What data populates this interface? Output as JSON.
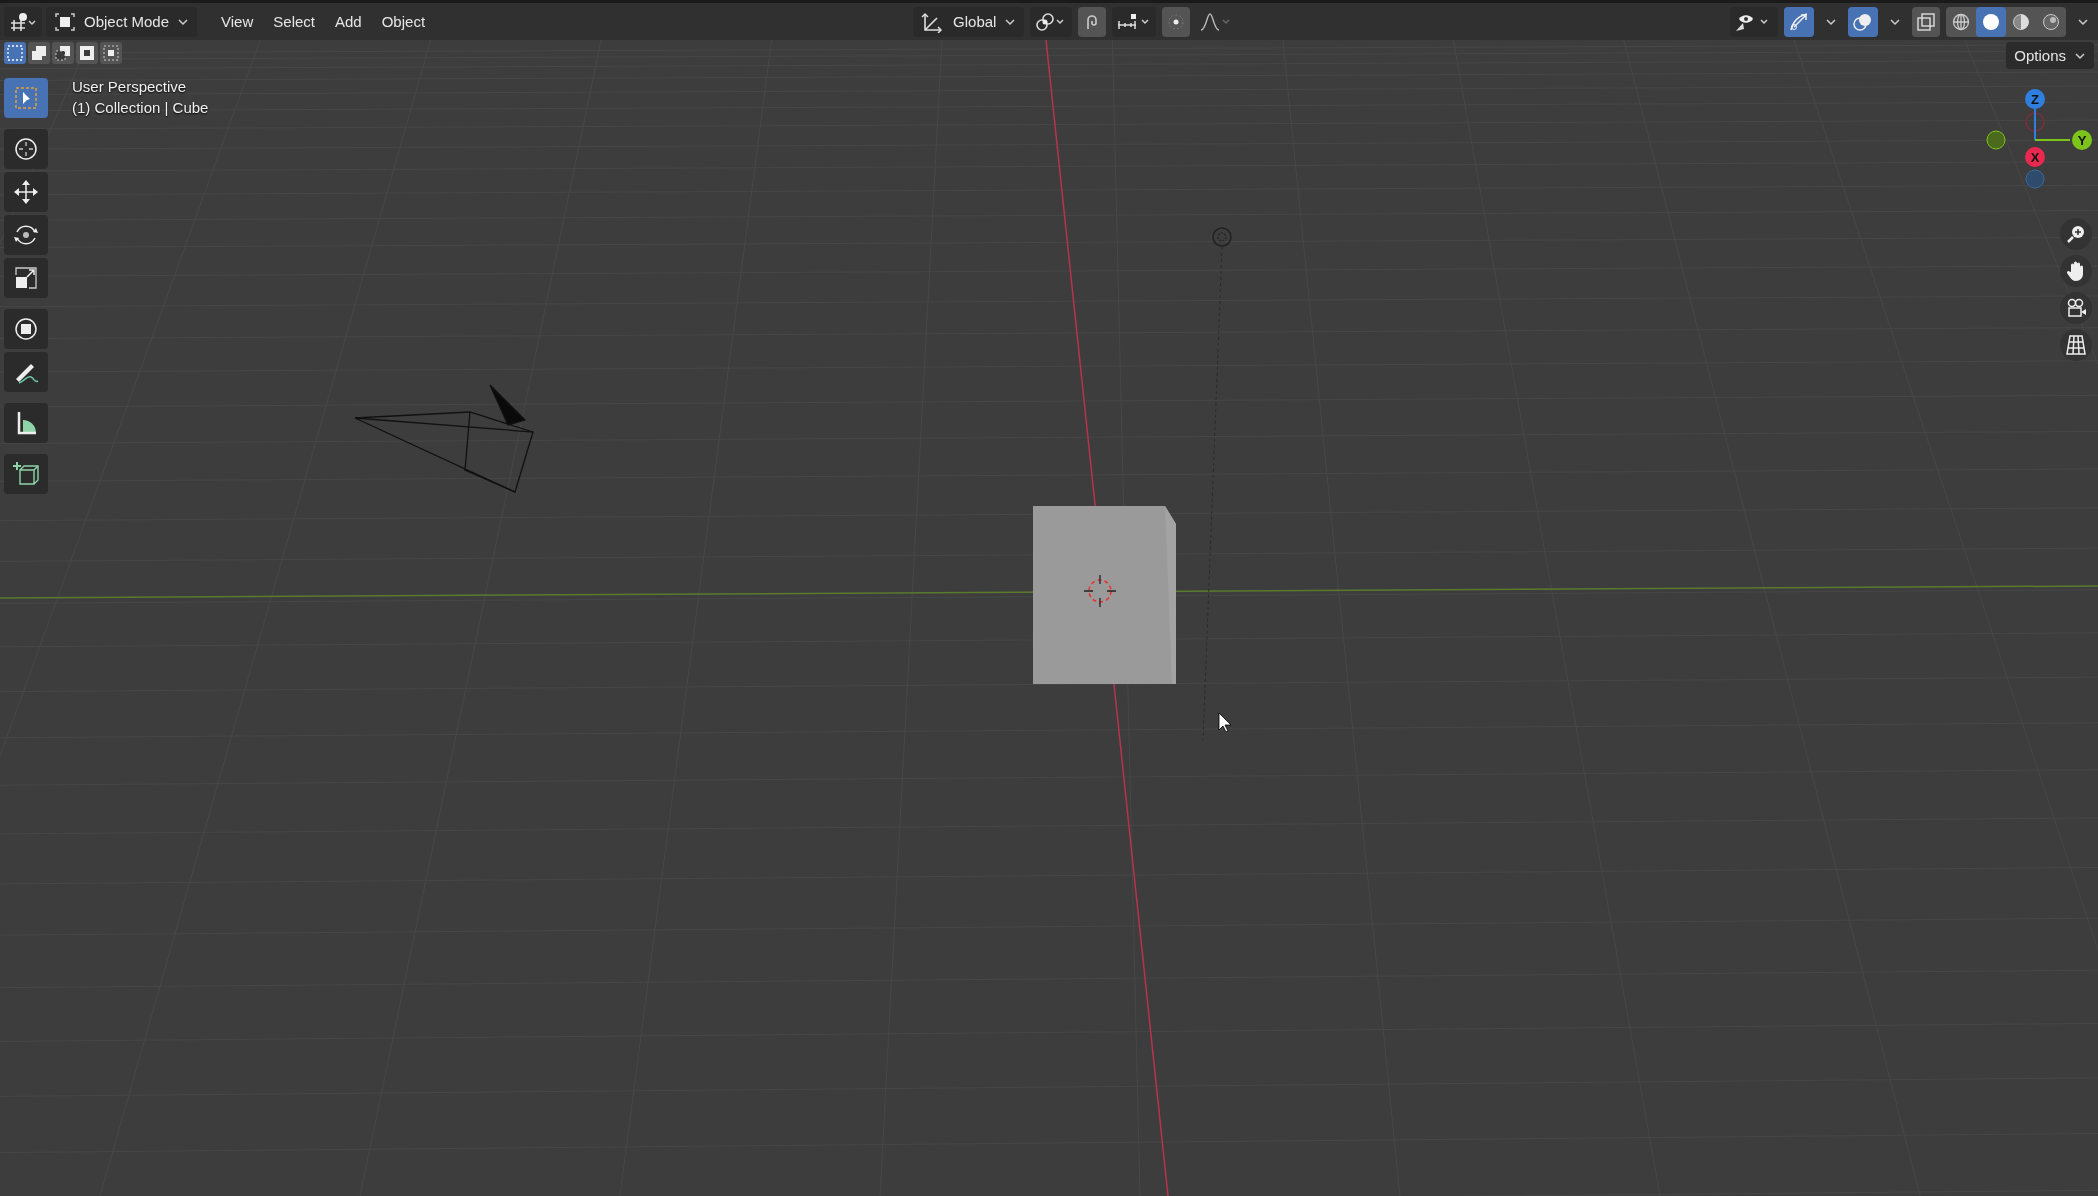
{
  "header": {
    "mode": {
      "label": "Object Mode"
    },
    "menus": [
      {
        "label": "View"
      },
      {
        "label": "Select"
      },
      {
        "label": "Add"
      },
      {
        "label": "Object"
      }
    ],
    "transform_orientation": {
      "label": "Global"
    },
    "gizmo_toggle": {
      "on": true
    },
    "overlay_toggle": {
      "on": true
    },
    "xray_toggle": {
      "on": false
    },
    "shading_modes": [
      {
        "kind": "wireframe",
        "selected": false
      },
      {
        "kind": "solid",
        "selected": true
      },
      {
        "kind": "material",
        "selected": false
      },
      {
        "kind": "rendered",
        "selected": false
      }
    ]
  },
  "select_modes": [
    {
      "kind": "new",
      "selected": true
    },
    {
      "kind": "extend",
      "selected": false
    },
    {
      "kind": "subtract",
      "selected": false
    },
    {
      "kind": "invert",
      "selected": false
    },
    {
      "kind": "intersect",
      "selected": false
    }
  ],
  "tools": [
    {
      "kind": "select",
      "selected": true
    },
    {
      "kind": "cursor",
      "selected": false
    },
    {
      "kind": "move",
      "selected": false
    },
    {
      "kind": "rotate",
      "selected": false
    },
    {
      "kind": "scale",
      "selected": false
    },
    {
      "kind": "transform",
      "selected": false
    },
    {
      "kind": "annotate",
      "selected": false
    },
    {
      "kind": "measure",
      "selected": false
    },
    {
      "kind": "add-cube",
      "selected": false
    }
  ],
  "viewport": {
    "view_name": "User Perspective",
    "context": "(1) Collection | Cube",
    "options": {
      "label": "Options"
    },
    "axes": [
      {
        "label": "Z",
        "color": "#2f7fe0"
      },
      {
        "label": "Y",
        "color": "#7cc41c"
      },
      {
        "label": "X",
        "color": "#e8284e"
      }
    ]
  }
}
